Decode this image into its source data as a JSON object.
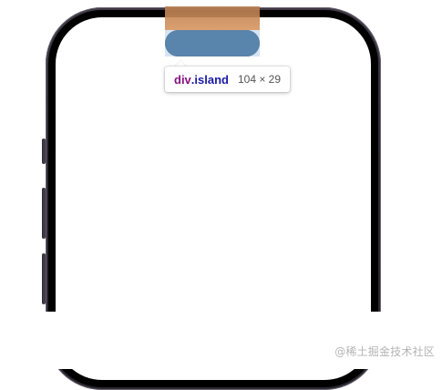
{
  "tooltip": {
    "tag": "div",
    "class_name": ".island",
    "size": "104 × 29"
  },
  "watermark": "@稀土掘金技术社区",
  "colors": {
    "margin_highlight": "#e29c5c",
    "content_highlight": "#6fa8dc",
    "phone_frame": "#2e2a34",
    "tag_color": "#881280",
    "class_color": "#1a1aa6"
  },
  "icons": {
    "island": "dynamic-island"
  }
}
